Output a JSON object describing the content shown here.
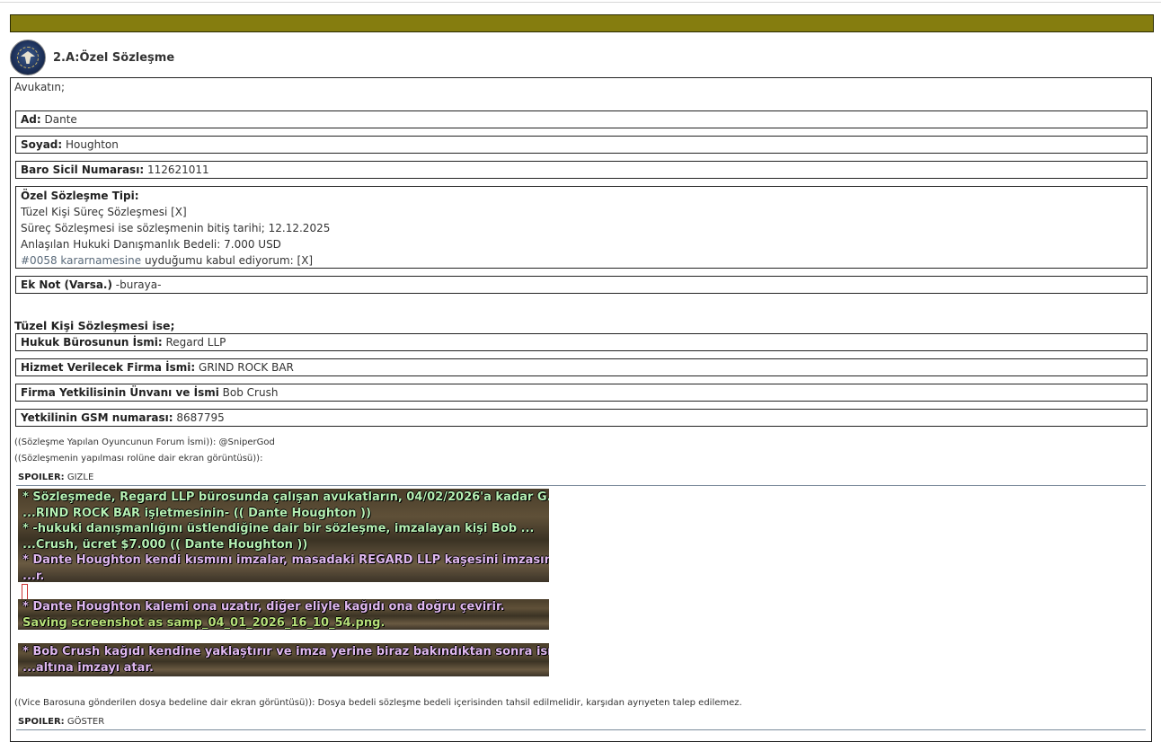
{
  "post": {
    "title": "2.A:Özel Sözleşme"
  },
  "intro": "Avukatın;",
  "fields": {
    "ad": {
      "label": "Ad:",
      "value": "Dante"
    },
    "soyad": {
      "label": "Soyad:",
      "value": "Houghton"
    },
    "baro": {
      "label": "Baro Sicil Numarası:",
      "value": "112621011"
    },
    "tip": {
      "label": "Özel Sözleşme Tipi:",
      "line1": "Tüzel Kişi Süreç Sözleşmesi [X]",
      "line2": "Süreç Sözleşmesi ise sözleşmenin bitiş tarihi; 12.12.2025",
      "line3": "Anlaşılan Hukuki Danışmanlık Bedeli: 7.000 USD",
      "line4_link": "#0058 kararnamesine",
      "line4_rest": " uyduğumu kabul ediyorum: [X]"
    },
    "eknot": {
      "label": "Ek Not (Varsa.)",
      "value": " -buraya-"
    }
  },
  "corporate": {
    "heading": "Tüzel Kişi Sözleşmesi ise;",
    "buro": {
      "label": "Hukuk Bürosunun İsmi:",
      "value": "Regard LLP"
    },
    "firma": {
      "label": "Hizmet Verilecek Firma İsmi:",
      "value": "GRIND ROCK BAR"
    },
    "yetkili": {
      "label": "Firma Yetkilisinin Ünvanı ve İsmi",
      "value": "Bob Crush"
    },
    "gsm": {
      "label": "Yetkilinin GSM numarası:",
      "value": "8687795"
    }
  },
  "notes": {
    "forum": "((Sözleşme Yapılan Oyuncunun Forum İsmi)): @SniperGod",
    "screenshot": "((Sözleşmenin yapılması rolüne dair ekran görüntüsü)):",
    "vice": "((Vice Barosuna gönderilen dosya bedeline dair ekran görüntüsü)): Dosya bedeli sözleşme bedeli içerisinden tahsil edilmelidir, karşıdan ayrıyeten talep edilemez."
  },
  "spoiler1": {
    "label": "SPOILER:",
    "action": "GIZLE"
  },
  "spoiler2": {
    "label": "SPOILER:",
    "action": "GÖSTER"
  },
  "chatlog": {
    "block1": [
      "* Sözleşmede, Regard LLP bürosunda çalışan avukatların, 04/02/2026'a kadar G...",
      "...RIND ROCK BAR işletmesinin-    (( Dante Houghton ))",
      "* -hukuki danışmanlığını üstlendiğine dair bir sözleşme, imzalayan kişi Bob ...",
      "...Crush, ücret $7.000 (( Dante Houghton ))",
      "* Dante Houghton kendi kısmını imzalar, masadaki REGARD LLP kaşesini imzasının üzer",
      "...r."
    ],
    "block2": [
      "* Dante Houghton kalemi ona uzatır, diğer eliyle kağıdı ona doğru çevirir.",
      "Saving screenshot as samp_04_01_2026_16_10_54.png."
    ],
    "block3": [
      "* Bob Crush kağıdı kendine yaklaştırır ve imza yerine biraz bakındıktan sonra isminin ...",
      "...altına imzayı atar."
    ]
  }
}
